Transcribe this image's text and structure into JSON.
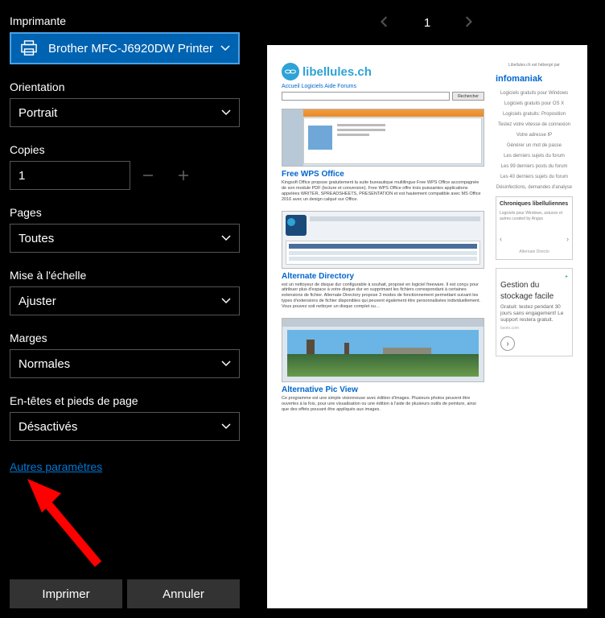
{
  "labels": {
    "printer": "Imprimante",
    "orientation": "Orientation",
    "copies": "Copies",
    "pages": "Pages",
    "scale": "Mise à l'échelle",
    "margins": "Marges",
    "headers": "En-têtes et pieds de page"
  },
  "values": {
    "printer": "Brother MFC-J6920DW Printer",
    "orientation": "Portrait",
    "copies": "1",
    "pages": "Toutes",
    "scale": "Ajuster",
    "margins": "Normales",
    "headers": "Désactivés"
  },
  "link_more": "Autres paramètres",
  "buttons": {
    "print": "Imprimer",
    "cancel": "Annuler"
  },
  "nav": {
    "page": "1"
  },
  "preview": {
    "logo_text": "libellules.ch",
    "menu": "Accueil   Logiciels   Aide   Forums",
    "search_btn": "Rechercher",
    "articles": [
      {
        "title": "Free WPS Office",
        "desc": "Kingsoft Office propose gratuitement la suite bureautique multilingue Free WPS Office accompagnée de son module PDF (lecture et conversion). Free WPS Office offre trois puissantes applications appelées WRITER, SPREADSHEETS, PRESENTATION et est hautement compatible avec MS Office 2016 avec un design calqué sur Office."
      },
      {
        "title": "Alternate Directory",
        "desc": "est un nettoyeur de disque dur configurable à souhait, proposé en logiciel freeware. Il est conçu pour attribuer plus d'espace à votre disque dur en supprimant les fichiers correspondant à certaines extensions de fichier. Alternate Directory propose 3 modes de fonctionnement permettant suivant les types d'extensions de fichier disponibles qui peuvent également être personnalisées individuellement. Vous pouvez soit nettoyer un disque complet ou…"
      },
      {
        "title": "Alternative Pic View",
        "desc": "Ce programme est une simple visionneuse avec édition d'images. Plusieurs photos peuvent être ouvertes à la fois, pour une visualisation ou une édition à l'aide de plusieurs outils de peinture, ainsi que des effets pouvant être appliqués aux images."
      }
    ],
    "sidebar": {
      "tag": "Libellules.ch est hébergé par",
      "brand": "infomaniak",
      "links": [
        "Logiciels gratuits pour Windows",
        "Logiciels gratuits pour OS X",
        "Logiciels gratuits: Proposition",
        "Testez votre vitesse de connexion",
        "Votre adresse IP",
        "Générer un mot de passe",
        "Les derniers sujets du forum",
        "Les 99 derniers posts du forum",
        "Les 40 derniers sujets du forum",
        "Désinfections, demandes d'analyse"
      ],
      "chron_hd": "Chroniques libelluliennes",
      "chron_sub": "Logiciels pour Windows, astuces et autres curated by Angus",
      "ad_h1": "Gestion du",
      "ad_h2": "stockage facile",
      "ad_txt": "Gratuit: testez pendant 30 jours sans engagement! Le support restera gratuit.",
      "ad_src": "bsoto.com"
    }
  }
}
